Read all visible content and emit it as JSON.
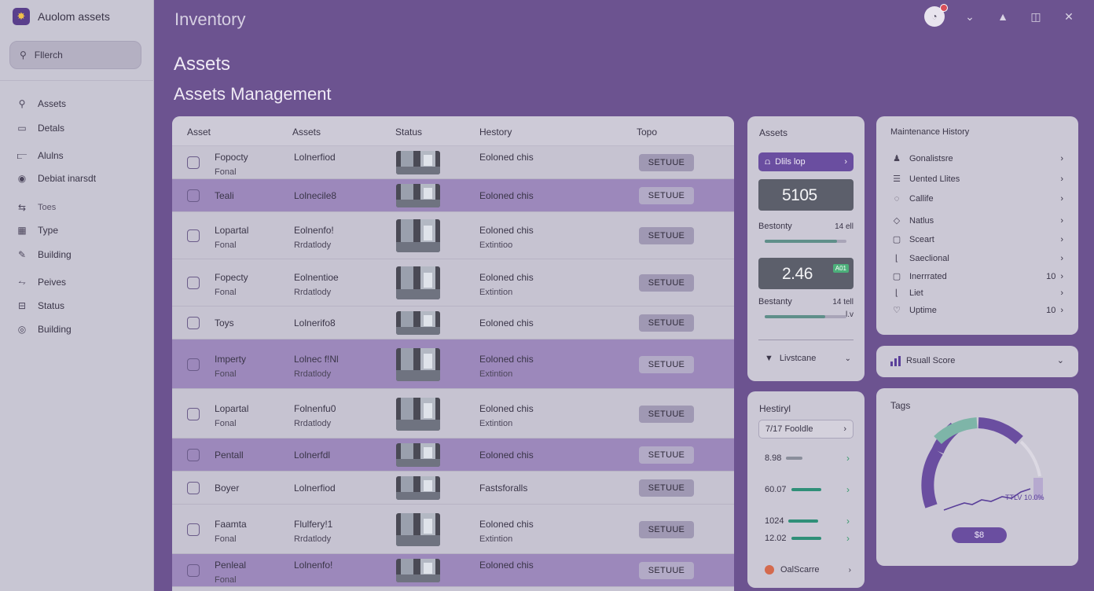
{
  "app": {
    "name": "Auolom assets",
    "logo_icon": "gear-logo-icon"
  },
  "search": {
    "placeholder": "Fllerch"
  },
  "sidebar": {
    "items": [
      {
        "label": "Assets",
        "icon": "search-icon"
      },
      {
        "label": "Detals",
        "icon": "doc-icon"
      },
      {
        "label": "Alulns",
        "icon": "bars-icon"
      },
      {
        "label": "Debiat inarsdt",
        "icon": "shield-icon"
      },
      {
        "label": "Toes",
        "icon": "arrows-icon"
      },
      {
        "label": "Type",
        "icon": "grid-icon"
      },
      {
        "label": "Building",
        "icon": "pen-icon"
      },
      {
        "label": "Peives",
        "icon": "link-icon"
      },
      {
        "label": "Status",
        "icon": "table-icon"
      },
      {
        "label": "Building",
        "icon": "globe-icon"
      }
    ]
  },
  "header": {
    "section": "Inventory",
    "title": "Assets",
    "subtitle": "Assets Management"
  },
  "table": {
    "columns": [
      "Asset",
      "Assets",
      "Status",
      "Hestory",
      "Topo"
    ],
    "rows": [
      {
        "name": "Fopocty",
        "sub": "Fonal",
        "assets": "Lolnerfiod",
        "assets_sub": "",
        "history": "Eoloned chis",
        "history_sub": "",
        "action": "SETUUE",
        "style": "plain"
      },
      {
        "name": "Teali",
        "sub": "",
        "assets": "Lolnecile8",
        "assets_sub": "",
        "history": "Eoloned chis",
        "history_sub": "",
        "action": "SETUUE",
        "style": "alt"
      },
      {
        "name": "Lopartal",
        "sub": "Fonal",
        "assets": "Eolnenfo!",
        "assets_sub": "Rrdatlody",
        "history": "Eoloned chis",
        "history_sub": "Extintioo",
        "action": "SETUUE",
        "style": "plain"
      },
      {
        "name": "Fopecty",
        "sub": "Fonal",
        "assets": "Eolnentioe",
        "assets_sub": "Rrdatlody",
        "history": "Eoloned chis",
        "history_sub": "Extintion",
        "action": "SETUUE",
        "style": "plain"
      },
      {
        "name": "Toys",
        "sub": "",
        "assets": "Lolnerifo8",
        "assets_sub": "",
        "history": "Eoloned chis",
        "history_sub": "",
        "action": "SETUUE",
        "style": "plain"
      },
      {
        "name": "Imperty",
        "sub": "Fonal",
        "assets": "Lolnec f!Nl",
        "assets_sub": "Rrdatlody",
        "history": "Eoloned chis",
        "history_sub": "Extintion",
        "action": "SETUUE",
        "style": "alt"
      },
      {
        "name": "Lopartal",
        "sub": "Fonal",
        "assets": "Folnenfu0",
        "assets_sub": "Rrdatlody",
        "history": "Eoloned chis",
        "history_sub": "Extintion",
        "action": "SETUUE",
        "style": "plain"
      },
      {
        "name": "Pentall",
        "sub": "",
        "assets": "Lolnerfdl",
        "assets_sub": "",
        "history": "Eoloned chis",
        "history_sub": "",
        "action": "SETUUE",
        "style": "alt"
      },
      {
        "name": "Boyer",
        "sub": "",
        "assets": "Lolnerfiod",
        "assets_sub": "",
        "history": "Fastsforalls",
        "history_sub": "",
        "action": "SETUUE",
        "style": "plain"
      },
      {
        "name": "Faamta",
        "sub": "Fonal",
        "assets": "Flulfery!1",
        "assets_sub": "Rrdatlody",
        "history": "Eoloned chis",
        "history_sub": "Extintion",
        "action": "SETUUE",
        "style": "plain"
      },
      {
        "name": "Penleal",
        "sub": "Fonal",
        "assets": "Lolnenfo!",
        "assets_sub": "",
        "history": "Eoloned chis",
        "history_sub": "",
        "action": "SETUUE",
        "style": "alt"
      }
    ]
  },
  "assets_panel": {
    "title": "Assets",
    "pill": "Dlils lop",
    "stat1": {
      "value": "5105",
      "label": "Bestonty",
      "right": "14 ell",
      "progress": 0.88
    },
    "stat2": {
      "value": "2.46",
      "tag": "A01",
      "label": "Bestanty",
      "right": "14 tell",
      "right2": "l.v",
      "progress": 0.74
    },
    "footer": "Livstcane"
  },
  "health_panel": {
    "title": "Hestiryl",
    "select": "7/17 Fooldle",
    "metrics": [
      {
        "value": "8.98",
        "progress": 0.55,
        "dim": true
      },
      {
        "value": "60.07",
        "progress": 1.0,
        "dim": false
      },
      {
        "value": "1024",
        "progress": 1.0,
        "dim": false
      },
      {
        "value": "12.02",
        "progress": 1.0,
        "dim": false
      }
    ],
    "footer": "OalScarre"
  },
  "maintenance": {
    "title": "Maintenance History",
    "items": [
      {
        "label": "Gonalistsre",
        "icon": "person-icon",
        "count": ""
      },
      {
        "label": "Uented Llites",
        "icon": "list-icon",
        "count": ""
      },
      {
        "label": "Callife",
        "icon": "circle-icon",
        "count": ""
      },
      {
        "label": "Natlus",
        "icon": "drop-icon",
        "count": ""
      },
      {
        "label": "Sceart",
        "icon": "box-icon",
        "count": ""
      },
      {
        "label": "Saeclional",
        "icon": "corner-icon",
        "count": ""
      },
      {
        "label": "Inerrrated",
        "icon": "square-icon",
        "count": "10"
      },
      {
        "label": "Liet",
        "icon": "corner-icon",
        "count": ""
      },
      {
        "label": "Uptime",
        "icon": "heart-icon",
        "count": "10"
      }
    ]
  },
  "score": {
    "label": "Rsuall Score"
  },
  "tags": {
    "title": "Tags",
    "label1": "TTLV",
    "label2": "10.0%",
    "pill": "$8"
  },
  "colors": {
    "accent": "#6a4ea0",
    "teal": "#2f8f78",
    "background": "#6c5390"
  }
}
